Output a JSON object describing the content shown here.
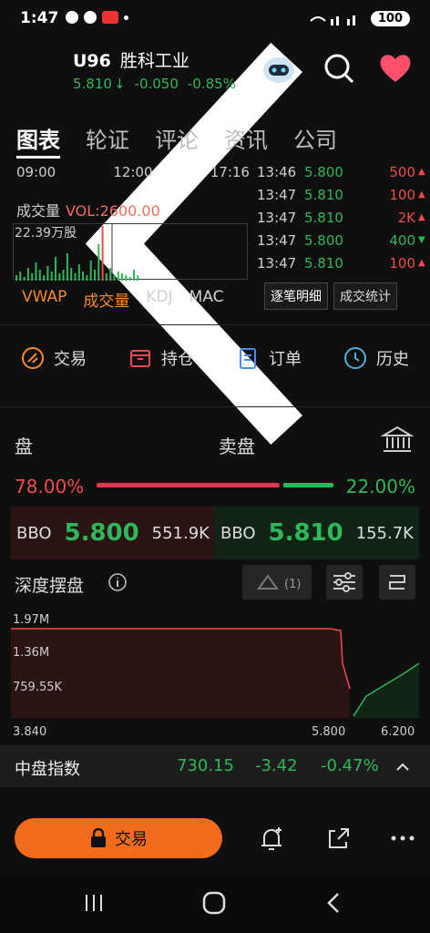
{
  "status": {
    "time": "1:47",
    "battery": "100"
  },
  "header": {
    "code": "U96",
    "name": "胜科工业",
    "price": "5.810",
    "arrow": "↓",
    "change": "-0.050",
    "change_pct": "-0.85%"
  },
  "tabs": [
    "图表",
    "轮证",
    "评论",
    "资讯",
    "公司"
  ],
  "chart": {
    "times": [
      "09:00",
      "12:00",
      "17:16"
    ],
    "vol_label": "成交量",
    "vol_value": "VOL:2600.00",
    "shares": "22.39万股"
  },
  "indicators": [
    "VWAP",
    "成交量",
    "KDJ",
    "MAC"
  ],
  "ticks": [
    {
      "time": "13:46",
      "price": "5.800",
      "qty": "500",
      "dir": "up"
    },
    {
      "time": "13:47",
      "price": "5.810",
      "qty": "100",
      "dir": "up"
    },
    {
      "time": "13:47",
      "price": "5.810",
      "qty": "2K",
      "dir": "up"
    },
    {
      "time": "13:47",
      "price": "5.800",
      "qty": "400",
      "dir": "down"
    },
    {
      "time": "13:47",
      "price": "5.810",
      "qty": "100",
      "dir": "up"
    }
  ],
  "tick_buttons": [
    "逐笔明细",
    "成交统计"
  ],
  "actions": [
    "交易",
    "持仓",
    "订单",
    "历史"
  ],
  "orderbook": {
    "buy_label": "盘",
    "sell_label": "卖盘",
    "buy_pct": "78.00%",
    "sell_pct": "22.00%",
    "buy_ratio": 0.78,
    "bid_label": "BBO",
    "bid_price": "5.800",
    "bid_size": "551.9K",
    "ask_label": "BBO",
    "ask_price": "5.810",
    "ask_size": "155.7K"
  },
  "depth": {
    "title": "深度摆盘",
    "y_labels": [
      "1.97M",
      "1.36M",
      "759.55K"
    ],
    "x_labels": [
      "3.840",
      "5.800",
      "6.200"
    ],
    "filter_label": "(1)"
  },
  "index_bar": {
    "name": "中盘指数",
    "value": "730.15",
    "change": "-3.42",
    "change_pct": "-0.47%"
  },
  "bottom": {
    "trade_label": "交易"
  },
  "colors": {
    "up": "#2fb85a",
    "down": "#f04a4a",
    "accent": "#f26a1b"
  }
}
